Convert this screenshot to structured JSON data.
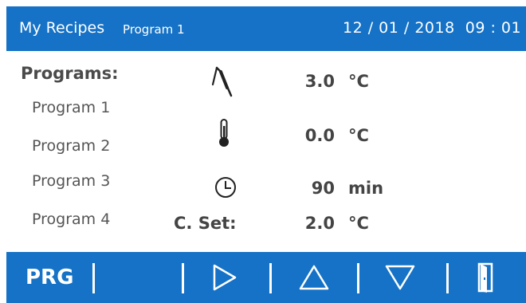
{
  "header": {
    "title": "My Recipes",
    "current_program": "Program 1",
    "datetime": "12 / 01 / 2018  09 : 01"
  },
  "programs": {
    "heading": "Programs:",
    "items": [
      "Program 1",
      "Program 2",
      "Program 3",
      "Program 4"
    ]
  },
  "readings": {
    "probe": {
      "value": "3.0",
      "unit": "°C",
      "icon": "probe-icon"
    },
    "temperature": {
      "value": "0.0",
      "unit": "°C",
      "icon": "thermometer-icon"
    },
    "time": {
      "value": "90",
      "unit": "min",
      "icon": "clock-icon"
    },
    "core_set": {
      "label": "C. Set:",
      "value": "2.0",
      "unit": "°C"
    }
  },
  "footer": {
    "prg_label": "PRG",
    "buttons": [
      "play-icon",
      "up-triangle-icon",
      "down-triangle-icon",
      "door-exit-icon"
    ]
  },
  "colors": {
    "accent": "#1572c6",
    "text": "#444444"
  }
}
